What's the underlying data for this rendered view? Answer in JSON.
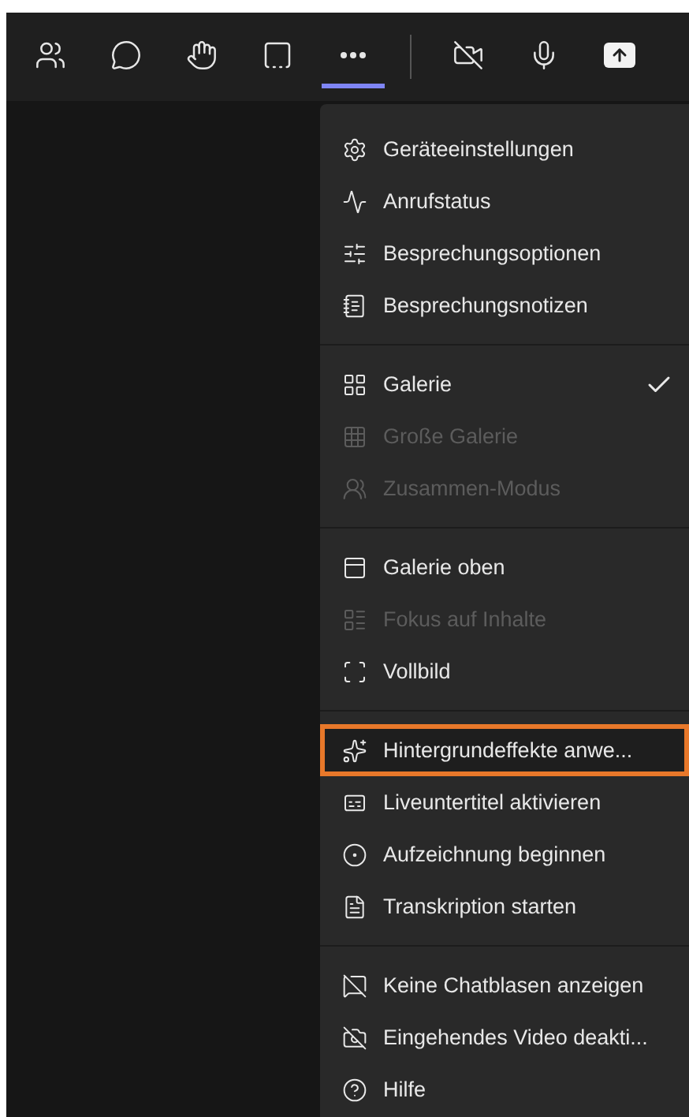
{
  "toolbar": {
    "buttons": [
      {
        "selected": false
      },
      {
        "selected": false
      },
      {
        "selected": false
      },
      {
        "selected": false
      },
      {
        "selected": true
      },
      {
        "selected": false
      },
      {
        "selected": false
      },
      {
        "selected": false
      }
    ]
  },
  "menu": {
    "groups": [
      {
        "items": [
          {
            "label": "Geräteeinstellungen",
            "disabled": false,
            "checked": false,
            "highlighted": false
          },
          {
            "label": "Anrufstatus",
            "disabled": false,
            "checked": false,
            "highlighted": false
          },
          {
            "label": "Besprechungsoptionen",
            "disabled": false,
            "checked": false,
            "highlighted": false
          },
          {
            "label": "Besprechungsnotizen",
            "disabled": false,
            "checked": false,
            "highlighted": false
          }
        ]
      },
      {
        "items": [
          {
            "label": "Galerie",
            "disabled": false,
            "checked": true,
            "highlighted": false
          },
          {
            "label": "Große Galerie",
            "disabled": true,
            "checked": false,
            "highlighted": false
          },
          {
            "label": "Zusammen-Modus",
            "disabled": true,
            "checked": false,
            "highlighted": false
          }
        ]
      },
      {
        "items": [
          {
            "label": "Galerie oben",
            "disabled": false,
            "checked": false,
            "highlighted": false
          },
          {
            "label": "Fokus auf Inhalte",
            "disabled": true,
            "checked": false,
            "highlighted": false
          },
          {
            "label": "Vollbild",
            "disabled": false,
            "checked": false,
            "highlighted": false
          }
        ]
      },
      {
        "items": [
          {
            "label": "Hintergrundeffekte anwe...",
            "disabled": false,
            "checked": false,
            "highlighted": true
          },
          {
            "label": "Liveuntertitel aktivieren",
            "disabled": false,
            "checked": false,
            "highlighted": false
          },
          {
            "label": "Aufzeichnung beginnen",
            "disabled": false,
            "checked": false,
            "highlighted": false
          },
          {
            "label": "Transkription starten",
            "disabled": false,
            "checked": false,
            "highlighted": false
          }
        ]
      },
      {
        "items": [
          {
            "label": "Keine Chatblasen anzeigen",
            "disabled": false,
            "checked": false,
            "highlighted": false
          },
          {
            "label": "Eingehendes Video deakti...",
            "disabled": false,
            "checked": false,
            "highlighted": false
          },
          {
            "label": "Hilfe",
            "disabled": false,
            "checked": false,
            "highlighted": false
          }
        ]
      }
    ]
  }
}
